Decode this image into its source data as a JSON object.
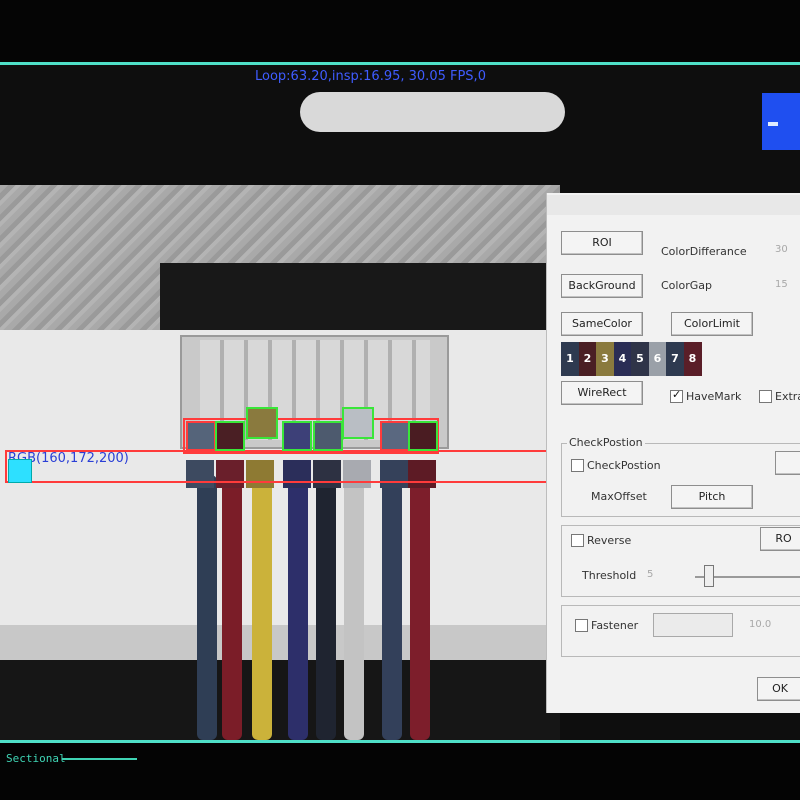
{
  "status_overlay": {
    "fps_text": "Loop:63.20,insp:16.95, 30.05 FPS,0"
  },
  "sample": {
    "rgb_text": "RGB(160,172,200)"
  },
  "dialog": {
    "buttons": {
      "roi": "ROI",
      "background": "BackGround",
      "same_color": "SameColor",
      "color_limit": "ColorLimit",
      "wire_rect": "WireRect",
      "pitch": "Pitch",
      "ok": "OK",
      "ro": "RO"
    },
    "color_difference": {
      "label": "ColorDifferance",
      "value": "30"
    },
    "color_gap": {
      "label": "ColorGap",
      "value": "15"
    },
    "swatches": [
      {
        "num": "1",
        "color": "#2e3a50"
      },
      {
        "num": "2",
        "color": "#4a1f24"
      },
      {
        "num": "3",
        "color": "#8a7a3e"
      },
      {
        "num": "4",
        "color": "#2a2d55"
      },
      {
        "num": "5",
        "color": "#2f3448"
      },
      {
        "num": "6",
        "color": "#9aa0a8"
      },
      {
        "num": "7",
        "color": "#2e3a50"
      },
      {
        "num": "8",
        "color": "#5a1e28"
      }
    ],
    "have_mark": {
      "label": "HaveMark",
      "checked": true
    },
    "extra": {
      "label": "Extra",
      "checked": false
    },
    "check_position_group": {
      "title": "CheckPostion",
      "checkbox_label": "CheckPostion",
      "max_offset_label": "MaxOffset"
    },
    "reverse": {
      "label": "Reverse"
    },
    "threshold": {
      "label": "Threshold",
      "value": "5"
    },
    "fastener": {
      "label": "Fastener",
      "value": "10.0"
    }
  },
  "footer": {
    "section_label": "Sectional"
  },
  "colors": {
    "frame_cyan": "#4fe0c8",
    "overlay_blue": "#3f5cff",
    "detect_red": "#ff3b3b",
    "detect_green": "#39e639"
  }
}
